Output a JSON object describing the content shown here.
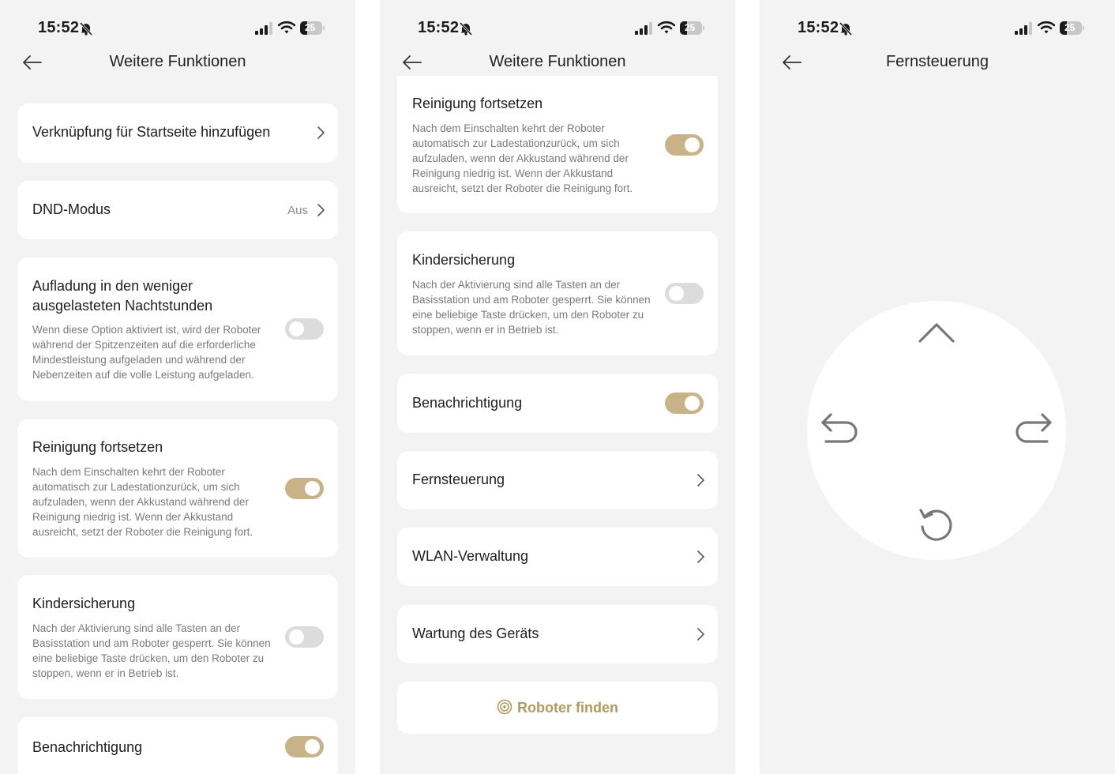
{
  "status": {
    "time": "15:52",
    "battery": "25"
  },
  "screen1": {
    "title": "Weitere Funktionen",
    "shortcut_label": "Verknüpfung für Startseite hinzufügen",
    "dnd_label": "DND-Modus",
    "dnd_value": "Aus",
    "offpeak_title": "Aufladung in den weniger ausgelasteten Nachtstunden",
    "offpeak_desc": "Wenn diese Option aktiviert ist, wird der Roboter während der Spitzenzeiten auf die erforderliche Mindestleistung aufgeladen und während der Nebenzeiten auf die volle Leistung aufgeladen.",
    "offpeak_on": false,
    "resume_title": "Reinigung fortsetzen",
    "resume_desc": "Nach dem Einschalten kehrt der Roboter automatisch zur Ladestationzurück, um sich aufzuladen, wenn der Akkustand während der Reinigung niedrig ist. Wenn der Akkustand ausreicht, setzt der Roboter die Reinigung fort.",
    "resume_on": true,
    "childlock_title": "Kindersicherung",
    "childlock_desc": "Nach der Aktivierung sind alle Tasten an der Basisstation und am Roboter gesperrt. Sie können eine beliebige Taste drücken, um den Roboter zu stoppen, wenn er in Betrieb ist.",
    "childlock_on": false,
    "notify_label": "Benachrichtigung",
    "notify_on": true
  },
  "screen2": {
    "title": "Weitere Funktionen",
    "resume_title": "Reinigung fortsetzen",
    "resume_desc": "Nach dem Einschalten kehrt der Roboter automatisch zur Ladestationzurück, um sich aufzuladen, wenn der Akkustand während der Reinigung niedrig ist. Wenn der Akkustand ausreicht, setzt der Roboter die Reinigung fort.",
    "childlock_title": "Kindersicherung",
    "childlock_desc": "Nach der Aktivierung sind alle Tasten an der Basisstation und am Roboter gesperrt. Sie können eine beliebige Taste drücken, um den Roboter zu stoppen, wenn er in Betrieb ist.",
    "notify_label": "Benachrichtigung",
    "remote_label": "Fernsteuerung",
    "wlan_label": "WLAN-Verwaltung",
    "maintenance_label": "Wartung des Geräts",
    "find_label": "Roboter finden"
  },
  "screen3": {
    "title": "Fernsteuerung",
    "controls": [
      "arrow-up-icon",
      "turn-left-icon",
      "turn-right-icon",
      "rotate-icon"
    ]
  },
  "colors": {
    "accent": "#c9b285",
    "accent_text": "#b59a5d",
    "background": "#f3f3f3",
    "card": "#ffffff",
    "toggle_off": "#dcdcdc"
  }
}
